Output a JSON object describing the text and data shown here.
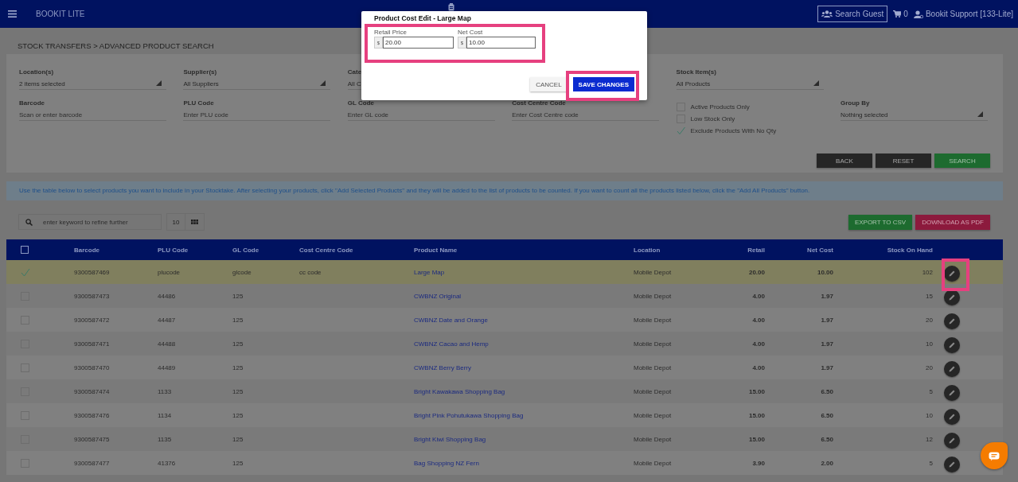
{
  "header": {
    "app_name": "BOOKIT LITE",
    "search_guest": "Search Guest",
    "cart_count": "0",
    "user": "Bookit Support [133-Lite]"
  },
  "breadcrumb": "STOCK TRANSFERS > ADVANCED PRODUCT SEARCH",
  "filters": {
    "location": {
      "label": "Location(s)",
      "value": "2 items selected"
    },
    "supplier": {
      "label": "Supplier(s)",
      "value": "All Suppliers"
    },
    "category": {
      "label": "Cate",
      "value": "All C"
    },
    "stock_items": {
      "label": "Stock Item(s)",
      "value": "All Products"
    },
    "barcode": {
      "label": "Barcode",
      "placeholder": "Scan or enter barcode"
    },
    "plu_code": {
      "label": "PLU Code",
      "placeholder": "Enter PLU code"
    },
    "gl_code": {
      "label": "GL Code",
      "placeholder": "Enter GL code"
    },
    "cost_centre_code": {
      "label": "Cost Centre Code",
      "placeholder": "Enter Cost Centre code"
    },
    "options": [
      {
        "label": "Active Products Only",
        "checked": false
      },
      {
        "label": "Low Stock Only",
        "checked": false
      },
      {
        "label": "Exclude Products With No Qty",
        "checked": true
      }
    ],
    "group_by": {
      "label": "Group By",
      "value": "Nothing selected"
    },
    "buttons": [
      {
        "label": "BACK",
        "kind": "dark"
      },
      {
        "label": "RESET",
        "kind": "dark"
      },
      {
        "label": "SEARCH",
        "kind": "success"
      }
    ]
  },
  "info": "Use the table below to select products you want to include in your Stocktake. After selecting your products, click \"Add Selected Products\" and they will be added to the list of products to be counted. If you want to count all the products listed below, click the \"Add All Products\" button.",
  "table_toolbar": {
    "search_placeholder": "enter keyword to refine further",
    "page_size": "10",
    "buttons": [
      {
        "label": "EXPORT TO CSV",
        "kind": "success"
      },
      {
        "label": "DOWNLOAD AS PDF",
        "kind": "danger"
      }
    ]
  },
  "table": {
    "select_all_checked": false,
    "columns": [
      "Barcode",
      "PLU Code",
      "GL Code",
      "Cost Centre Code",
      "Product Name",
      "Location",
      "Retail",
      "Net Cost",
      "Stock On Hand"
    ],
    "rows": [
      {
        "selected": true,
        "barcode": "9300587469",
        "plu_code": "plucode",
        "gl_code": "glcode",
        "cost_centre_code": "cc code",
        "product_name": "Large Map",
        "location": "Mobile Depot",
        "retail": "20.00",
        "net_cost": "10.00",
        "stock_on_hand": "102"
      },
      {
        "selected": false,
        "barcode": "9300587473",
        "plu_code": "44486",
        "gl_code": "125",
        "product_name": "CWBNZ Original",
        "location": "Mobile Depot",
        "retail": "4.00",
        "net_cost": "1.97",
        "stock_on_hand": "15"
      },
      {
        "selected": false,
        "barcode": "9300587472",
        "plu_code": "44487",
        "gl_code": "125",
        "product_name": "CWBNZ Date and Orange",
        "location": "Mobile Depot",
        "retail": "4.00",
        "net_cost": "1.97",
        "stock_on_hand": "20"
      },
      {
        "selected": false,
        "barcode": "9300587471",
        "plu_code": "44488",
        "gl_code": "125",
        "product_name": "CWBNZ Cacao and Hemp",
        "location": "Mobile Depot",
        "retail": "4.00",
        "net_cost": "1.97",
        "stock_on_hand": "10"
      },
      {
        "selected": false,
        "barcode": "9300587470",
        "plu_code": "44489",
        "gl_code": "125",
        "product_name": "CWBNZ Berry Berry",
        "location": "Mobile Depot",
        "retail": "4.00",
        "net_cost": "1.97",
        "stock_on_hand": "20"
      },
      {
        "selected": false,
        "barcode": "9300587474",
        "plu_code": "1133",
        "gl_code": "125",
        "product_name": "Bright Kawakawa Shopping Bag",
        "location": "Mobile Depot",
        "retail": "15.00",
        "net_cost": "6.50",
        "stock_on_hand": "5"
      },
      {
        "selected": false,
        "barcode": "9300587476",
        "plu_code": "1134",
        "gl_code": "125",
        "product_name": "Bright Pink Pohutukawa Shopping Bag",
        "location": "Mobile Depot",
        "retail": "15.00",
        "net_cost": "6.50",
        "stock_on_hand": "10"
      },
      {
        "selected": false,
        "barcode": "9300587475",
        "plu_code": "1135",
        "gl_code": "125",
        "product_name": "Bright Kiwi Shopping Bag",
        "location": "Mobile Depot",
        "retail": "15.00",
        "net_cost": "6.50",
        "stock_on_hand": "12"
      },
      {
        "selected": false,
        "barcode": "9300587477",
        "plu_code": "41376",
        "gl_code": "125",
        "product_name": "Bag Shopping NZ Fern",
        "location": "Mobile Depot",
        "retail": "3.90",
        "net_cost": "2.00",
        "stock_on_hand": "5"
      }
    ]
  },
  "modal": {
    "title": "Product Cost Edit - Large Map",
    "fields": [
      {
        "label": "Retail Price",
        "prefix": "$",
        "value": "20.00"
      },
      {
        "label": "Net Cost",
        "prefix": "$",
        "value": "10.00"
      }
    ],
    "buttons": [
      {
        "label": "CANCEL",
        "kind": "secondary"
      },
      {
        "label": "SAVE CHANGES",
        "kind": "primary"
      }
    ]
  }
}
